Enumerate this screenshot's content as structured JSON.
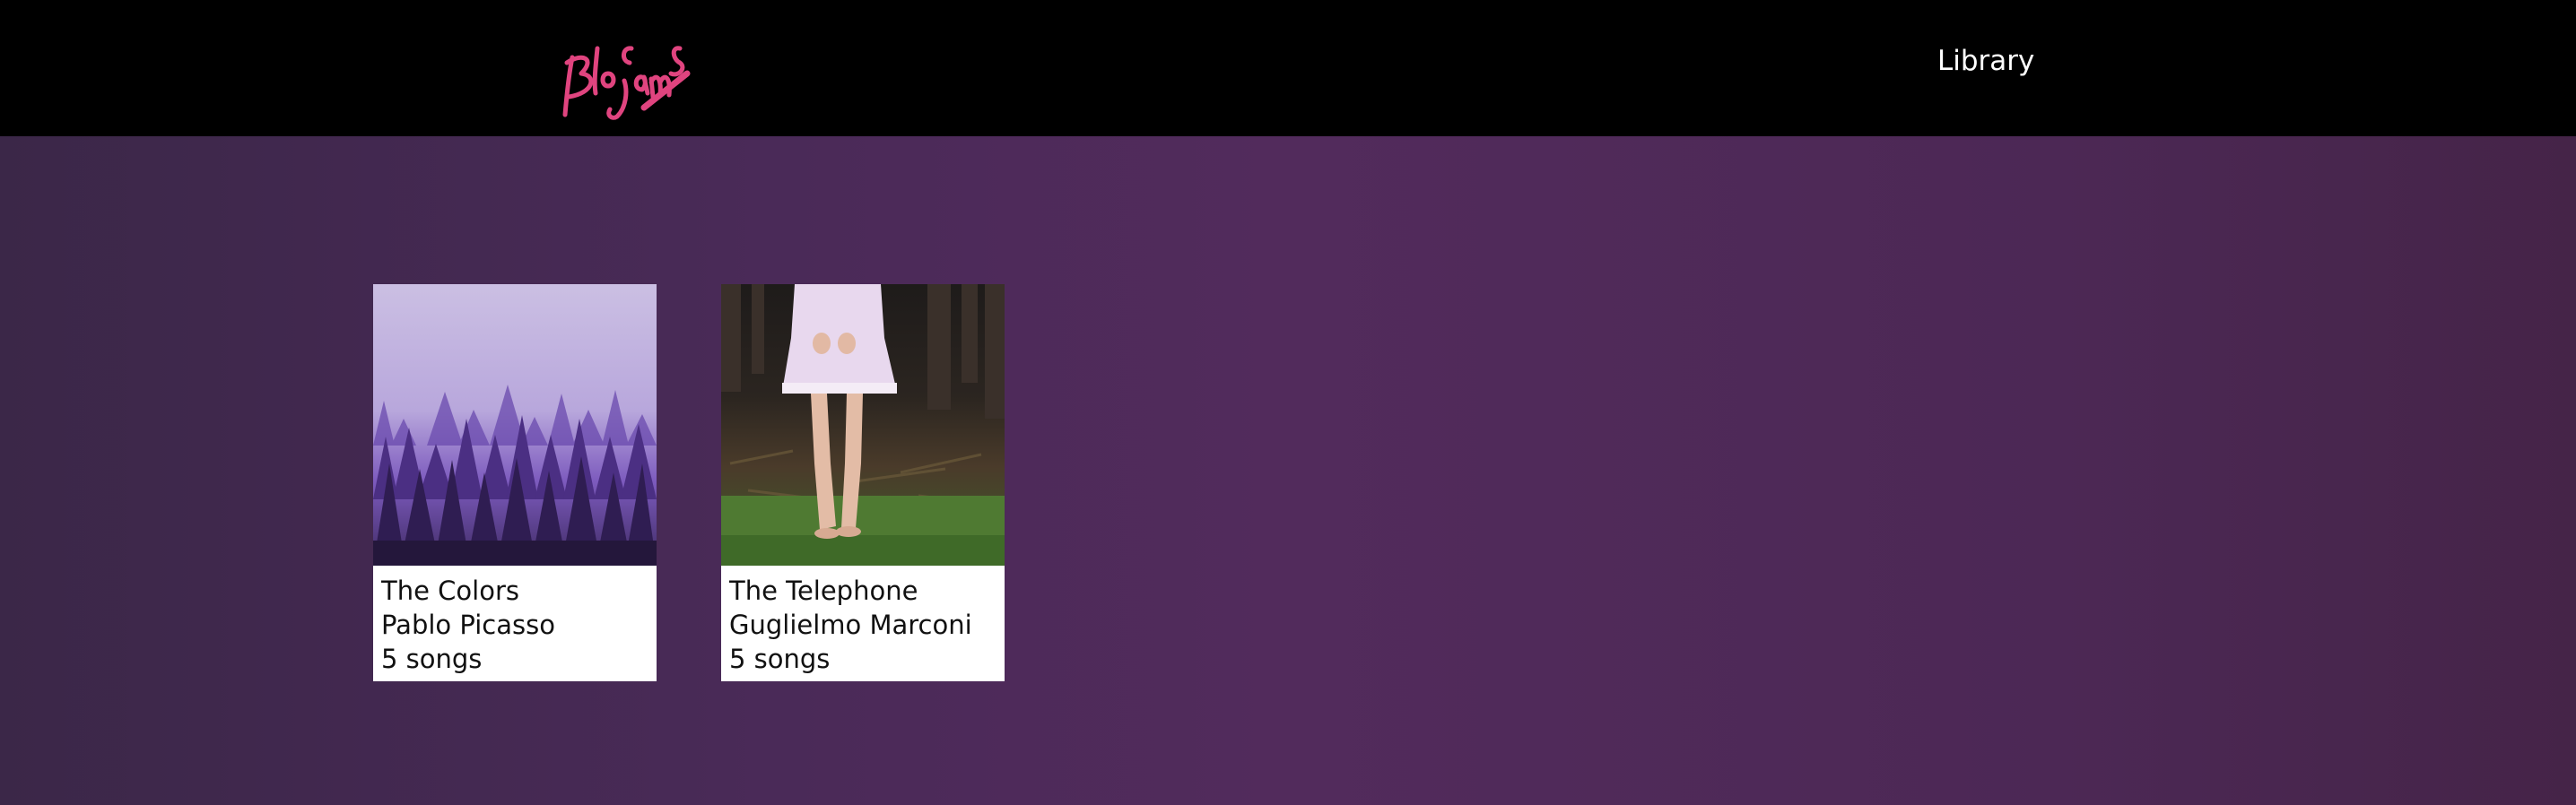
{
  "header": {
    "logo_text": "Bloc Jams",
    "logo_icon": "bloc-jams-logo",
    "nav_link": "Library"
  },
  "albums": [
    {
      "title": "The Colors",
      "artist": "Pablo Picasso",
      "song_count": "5 songs",
      "cover_icon": "misty-purple-forest-image"
    },
    {
      "title": "The Telephone",
      "artist": "Guglielmo Marconi",
      "song_count": "5 songs",
      "cover_icon": "girl-in-dress-forest-image"
    }
  ],
  "colors": {
    "header_bg": "#000000",
    "logo": "#e0447f",
    "page_bg": "#4a2a58",
    "card_bg": "#ffffff"
  }
}
